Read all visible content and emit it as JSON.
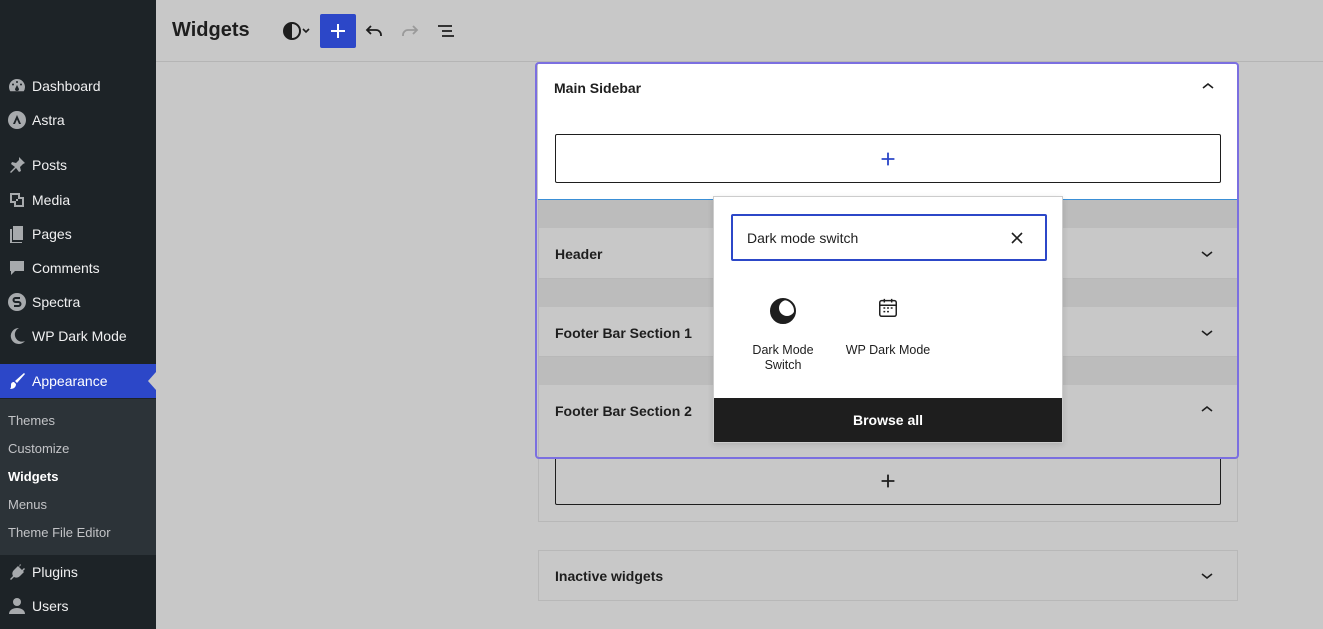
{
  "sidebar": {
    "items": [
      {
        "label": "Dashboard",
        "icon": "dashboard-icon"
      },
      {
        "label": "Astra",
        "icon": "astra-icon"
      },
      {
        "label": "Posts",
        "icon": "pin-icon"
      },
      {
        "label": "Media",
        "icon": "media-icon"
      },
      {
        "label": "Pages",
        "icon": "pages-icon"
      },
      {
        "label": "Comments",
        "icon": "comments-icon"
      },
      {
        "label": "Spectra",
        "icon": "spectra-icon"
      },
      {
        "label": "WP Dark Mode",
        "icon": "moon-icon"
      },
      {
        "label": "Appearance",
        "icon": "brush-icon"
      },
      {
        "label": "Plugins",
        "icon": "plug-icon"
      },
      {
        "label": "Users",
        "icon": "user-icon"
      }
    ],
    "submenu": [
      "Themes",
      "Customize",
      "Widgets",
      "Menus",
      "Theme File Editor"
    ]
  },
  "header": {
    "title": "Widgets"
  },
  "areas": {
    "main_sidebar": "Main Sidebar",
    "header": "Header",
    "footer1": "Footer Bar Section 1",
    "footer2": "Footer Bar Section 2",
    "inactive": "Inactive widgets"
  },
  "inserter": {
    "search_value": "Dark mode switch",
    "results": [
      {
        "label": "Dark Mode Switch",
        "icon": "half-moon-icon"
      },
      {
        "label": "WP Dark Mode",
        "icon": "calendar-icon"
      }
    ],
    "browse_all": "Browse all"
  },
  "colors": {
    "admin_blue": "#2c47c8",
    "sidebar_bg": "#1d2327",
    "selection_purple": "#7b6fe0"
  }
}
